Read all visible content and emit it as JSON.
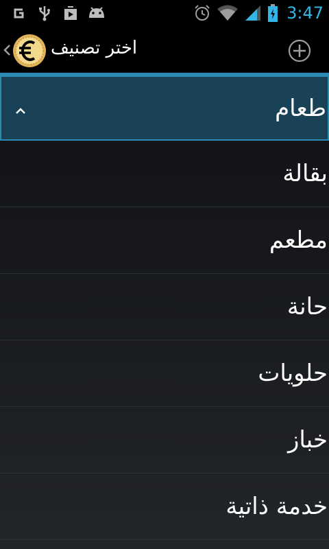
{
  "status_bar": {
    "time": "3:47",
    "left_icons": [
      "g-icon",
      "usb-icon",
      "play-store-icon",
      "android-icon"
    ],
    "right_icons": [
      "alarm-icon",
      "wifi-icon",
      "signal-icon",
      "battery-icon"
    ],
    "accent": "#33b5e5"
  },
  "action_bar": {
    "title": "اختر تصنيف",
    "app_icon": "euro-coin-icon",
    "action_icon": "add-icon"
  },
  "list": {
    "selected_item": "طعام",
    "items": [
      "بقالة",
      "مطعم",
      "حانة",
      "حلويات",
      "خباز",
      "خدمة ذاتية"
    ]
  },
  "colors": {
    "selected_bg": "#1a4256",
    "selected_border": "#2a8bb3",
    "divider": "#2a8bb3"
  }
}
